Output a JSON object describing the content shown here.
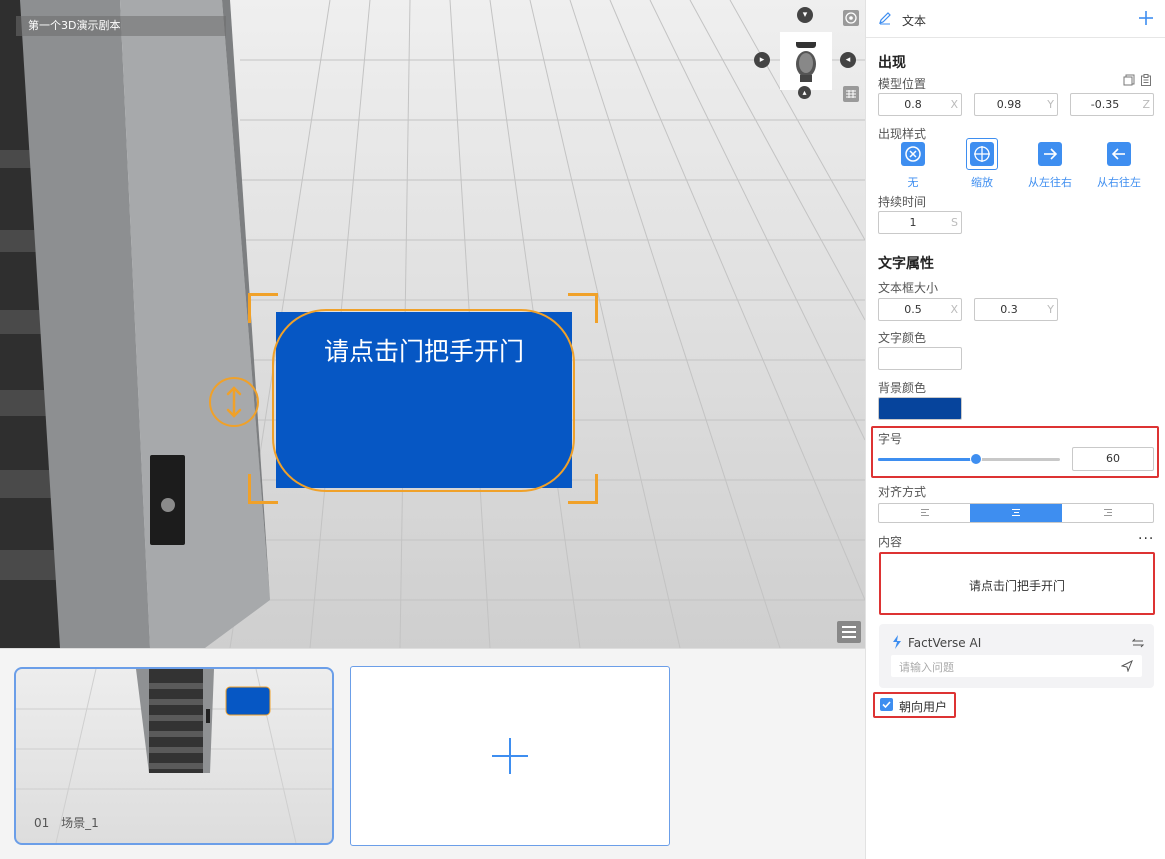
{
  "viewport": {
    "scene_title": "第一个3D演示剧本",
    "text_card_label": "请点击门把手开门",
    "icons": [
      "chevron-down-icon",
      "target-icon",
      "chevron-right-icon",
      "chevron-left-icon",
      "head-camera-icon",
      "chevron-up-icon",
      "grid-icon",
      "list-icon",
      "move-vertical-icon"
    ]
  },
  "scenes": {
    "items": [
      {
        "number": "01",
        "name": "场景_1",
        "selected": true
      }
    ],
    "add_icon": "plus-icon"
  },
  "panel": {
    "header_title": "文本",
    "appear_section_title": "出现",
    "model_position_label": "模型位置",
    "position": {
      "x": "0.8",
      "y": "0.98",
      "z": "-0.35"
    },
    "axis_units": {
      "x": "X",
      "y": "Y",
      "z": "Z"
    },
    "appear_style_label": "出现样式",
    "appear_styles": [
      "无",
      "缩放",
      "从左往右",
      "从右往左"
    ],
    "appear_style_selected": "缩放",
    "duration_label": "持续时间",
    "duration_value": "1",
    "duration_unit": "S",
    "text_section_title": "文字属性",
    "box_size_label": "文本框大小",
    "box_size": {
      "x": "0.5",
      "y": "0.3"
    },
    "text_color_label": "文字颜色",
    "text_color": "#ffffff",
    "bg_color_label": "背景颜色",
    "bg_color": "#06449c",
    "font_size_label": "字号",
    "font_size_value": "60",
    "font_size_slider_fraction": 0.54,
    "align_label": "对齐方式",
    "align_options": [
      "left",
      "center",
      "right"
    ],
    "align_selected": "center",
    "content_label": "内容",
    "content_value": "请点击门把手开门",
    "ai_title": "FactVerse AI",
    "ai_placeholder": "请输入问题",
    "face_user_label": "朝向用户",
    "face_user_checked": true
  },
  "colors": {
    "accent": "#3e8ef0",
    "card_blue": "#0657c4",
    "selection_orange": "#f0a129",
    "highlight_red": "#dd3333"
  }
}
